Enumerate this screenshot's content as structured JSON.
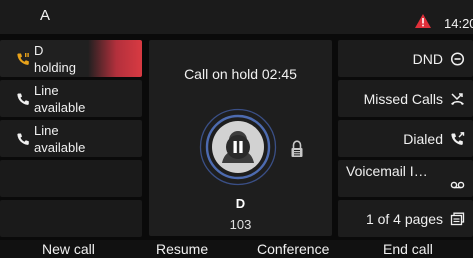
{
  "status_bar": {
    "account": "A",
    "alert_icon": "warning-triangle-icon",
    "time": "14:20",
    "alert_color": "#e0303a"
  },
  "line_keys": [
    {
      "icon": "phone-hold-icon",
      "line1": "D",
      "line2": "holding",
      "state": "active"
    },
    {
      "icon": "phone-icon",
      "line1": "Line",
      "line2": "available",
      "state": "idle"
    },
    {
      "icon": "phone-icon",
      "line1": "Line",
      "line2": "available",
      "state": "idle"
    },
    {
      "state": "empty"
    },
    {
      "state": "empty"
    }
  ],
  "call": {
    "status": "Call on hold 02:45",
    "caller_name": "D",
    "caller_number": "103",
    "avatar_icon": "person-pause-icon",
    "secure_icon": "lock-icon"
  },
  "right_keys": [
    {
      "label": "DND",
      "icon": "minus-circle-icon"
    },
    {
      "label": "Missed Calls",
      "icon": "missed-call-icon"
    },
    {
      "label": "Dialed",
      "icon": "outgoing-call-icon"
    },
    {
      "label": "Voicemail I…",
      "icon": "voicemail-icon"
    },
    {
      "label": "1 of 4 pages",
      "icon": "pages-icon"
    }
  ],
  "softkeys": [
    "New call",
    "Resume",
    "Conference",
    "End call"
  ],
  "colors": {
    "hold_accent": "#e8a21a",
    "active_gradient_end": "#d83a42",
    "panel": "#1e1e1e"
  }
}
